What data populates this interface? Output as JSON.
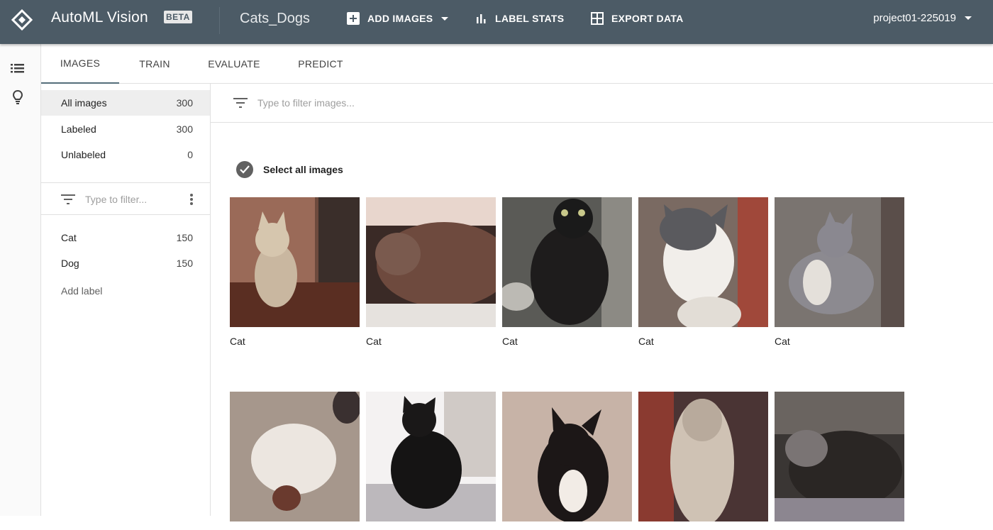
{
  "header": {
    "app_title": "AutoML Vision",
    "beta_badge": "BETA",
    "dataset_name": "Cats_Dogs",
    "add_images_label": "ADD IMAGES",
    "label_stats_label": "LABEL STATS",
    "export_data_label": "EXPORT DATA",
    "project_name": "project01-225019"
  },
  "tabs": [
    {
      "label": "IMAGES",
      "active": true
    },
    {
      "label": "TRAIN",
      "active": false
    },
    {
      "label": "EVALUATE",
      "active": false
    },
    {
      "label": "PREDICT",
      "active": false
    }
  ],
  "sidebar": {
    "summary": [
      {
        "label": "All images",
        "count": "300"
      },
      {
        "label": "Labeled",
        "count": "300"
      },
      {
        "label": "Unlabeled",
        "count": "0"
      }
    ],
    "filter_placeholder": "Type to filter...",
    "labels": [
      {
        "label": "Cat",
        "count": "150"
      },
      {
        "label": "Dog",
        "count": "150"
      }
    ],
    "add_label": "Add label"
  },
  "main": {
    "filter_placeholder": "Type to filter images...",
    "select_all_label": "Select all images",
    "images": [
      {
        "caption": "Cat"
      },
      {
        "caption": "Cat"
      },
      {
        "caption": "Cat"
      },
      {
        "caption": "Cat"
      },
      {
        "caption": "Cat"
      },
      {
        "caption": ""
      },
      {
        "caption": ""
      },
      {
        "caption": ""
      },
      {
        "caption": ""
      },
      {
        "caption": ""
      }
    ]
  },
  "colors": {
    "topbar": "#4c5b66",
    "tab_indicator": "#546e7a",
    "selected_row": "#eeeeee"
  }
}
